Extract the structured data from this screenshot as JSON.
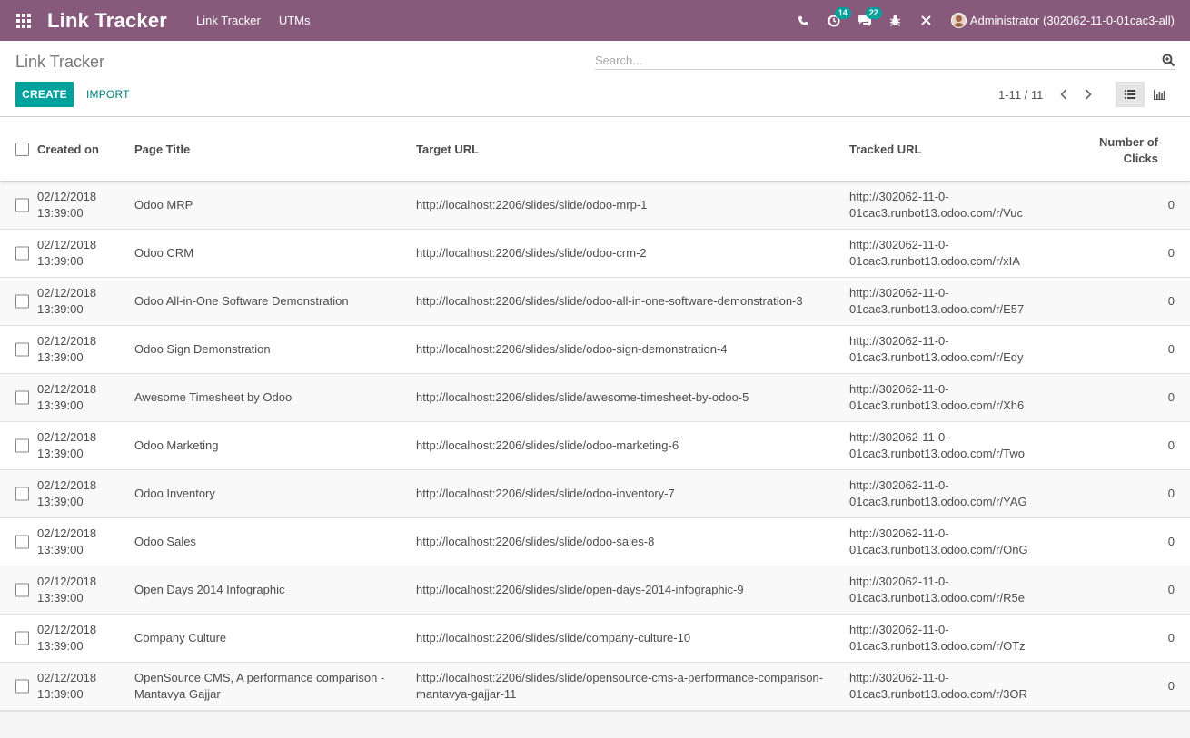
{
  "navbar": {
    "brand": "Link Tracker",
    "menus": [
      "Link Tracker",
      "UTMs"
    ],
    "icons": [
      "phone-icon",
      "activity-icon",
      "chat-icon",
      "bug-icon",
      "close-tools-icon"
    ],
    "activity_badge": "14",
    "chat_badge": "22",
    "user": "Administrator (302062-11-0-01cac3-all)"
  },
  "control_panel": {
    "breadcrumb": "Link Tracker",
    "search_placeholder": "Search...",
    "create_label": "CREATE",
    "import_label": "IMPORT",
    "pager": "1-11 / 11"
  },
  "table": {
    "headers": {
      "created_on": "Created on",
      "page_title": "Page Title",
      "target_url": "Target URL",
      "tracked_url": "Tracked URL",
      "clicks_1": "Number of",
      "clicks_2": "Clicks"
    },
    "rows": [
      {
        "date": "02/12/2018",
        "time": "13:39:00",
        "title": "Odoo MRP",
        "target": "http://localhost:2206/slides/slide/odoo-mrp-1",
        "tracked_1": "http://302062-11-0-",
        "tracked_2": "01cac3.runbot13.odoo.com/r/Vuc",
        "clicks": "0"
      },
      {
        "date": "02/12/2018",
        "time": "13:39:00",
        "title": "Odoo CRM",
        "target": "http://localhost:2206/slides/slide/odoo-crm-2",
        "tracked_1": "http://302062-11-0-",
        "tracked_2": "01cac3.runbot13.odoo.com/r/xIA",
        "clicks": "0"
      },
      {
        "date": "02/12/2018",
        "time": "13:39:00",
        "title": "Odoo All-in-One Software Demonstration",
        "target": "http://localhost:2206/slides/slide/odoo-all-in-one-software-demonstration-3",
        "tracked_1": "http://302062-11-0-",
        "tracked_2": "01cac3.runbot13.odoo.com/r/E57",
        "clicks": "0"
      },
      {
        "date": "02/12/2018",
        "time": "13:39:00",
        "title": "Odoo Sign Demonstration",
        "target": "http://localhost:2206/slides/slide/odoo-sign-demonstration-4",
        "tracked_1": "http://302062-11-0-",
        "tracked_2": "01cac3.runbot13.odoo.com/r/Edy",
        "clicks": "0"
      },
      {
        "date": "02/12/2018",
        "time": "13:39:00",
        "title": "Awesome Timesheet by Odoo",
        "target": "http://localhost:2206/slides/slide/awesome-timesheet-by-odoo-5",
        "tracked_1": "http://302062-11-0-",
        "tracked_2": "01cac3.runbot13.odoo.com/r/Xh6",
        "clicks": "0"
      },
      {
        "date": "02/12/2018",
        "time": "13:39:00",
        "title": "Odoo Marketing",
        "target": "http://localhost:2206/slides/slide/odoo-marketing-6",
        "tracked_1": "http://302062-11-0-",
        "tracked_2": "01cac3.runbot13.odoo.com/r/Two",
        "clicks": "0"
      },
      {
        "date": "02/12/2018",
        "time": "13:39:00",
        "title": "Odoo Inventory",
        "target": "http://localhost:2206/slides/slide/odoo-inventory-7",
        "tracked_1": "http://302062-11-0-",
        "tracked_2": "01cac3.runbot13.odoo.com/r/YAG",
        "clicks": "0"
      },
      {
        "date": "02/12/2018",
        "time": "13:39:00",
        "title": "Odoo Sales",
        "target": "http://localhost:2206/slides/slide/odoo-sales-8",
        "tracked_1": "http://302062-11-0-",
        "tracked_2": "01cac3.runbot13.odoo.com/r/OnG",
        "clicks": "0"
      },
      {
        "date": "02/12/2018",
        "time": "13:39:00",
        "title": "Open Days 2014 Infographic",
        "target": "http://localhost:2206/slides/slide/open-days-2014-infographic-9",
        "tracked_1": "http://302062-11-0-",
        "tracked_2": "01cac3.runbot13.odoo.com/r/R5e",
        "clicks": "0"
      },
      {
        "date": "02/12/2018",
        "time": "13:39:00",
        "title": "Company Culture",
        "target": "http://localhost:2206/slides/slide/company-culture-10",
        "tracked_1": "http://302062-11-0-",
        "tracked_2": "01cac3.runbot13.odoo.com/r/OTz",
        "clicks": "0"
      },
      {
        "date": "02/12/2018",
        "time": "13:39:00",
        "title_1": "OpenSource CMS, A performance comparison -",
        "title_2": "Mantavya Gajjar",
        "target_1": "http://localhost:2206/slides/slide/opensource-cms-a-performance-comparison-",
        "target_2": "mantavya-gajjar-11",
        "tracked_1": "http://302062-11-0-",
        "tracked_2": "01cac3.runbot13.odoo.com/r/3OR",
        "clicks": "0"
      }
    ]
  },
  "colors": {
    "navbar": "#875a7b",
    "primary_button": "#00a09d",
    "badge": "#00a09d"
  }
}
